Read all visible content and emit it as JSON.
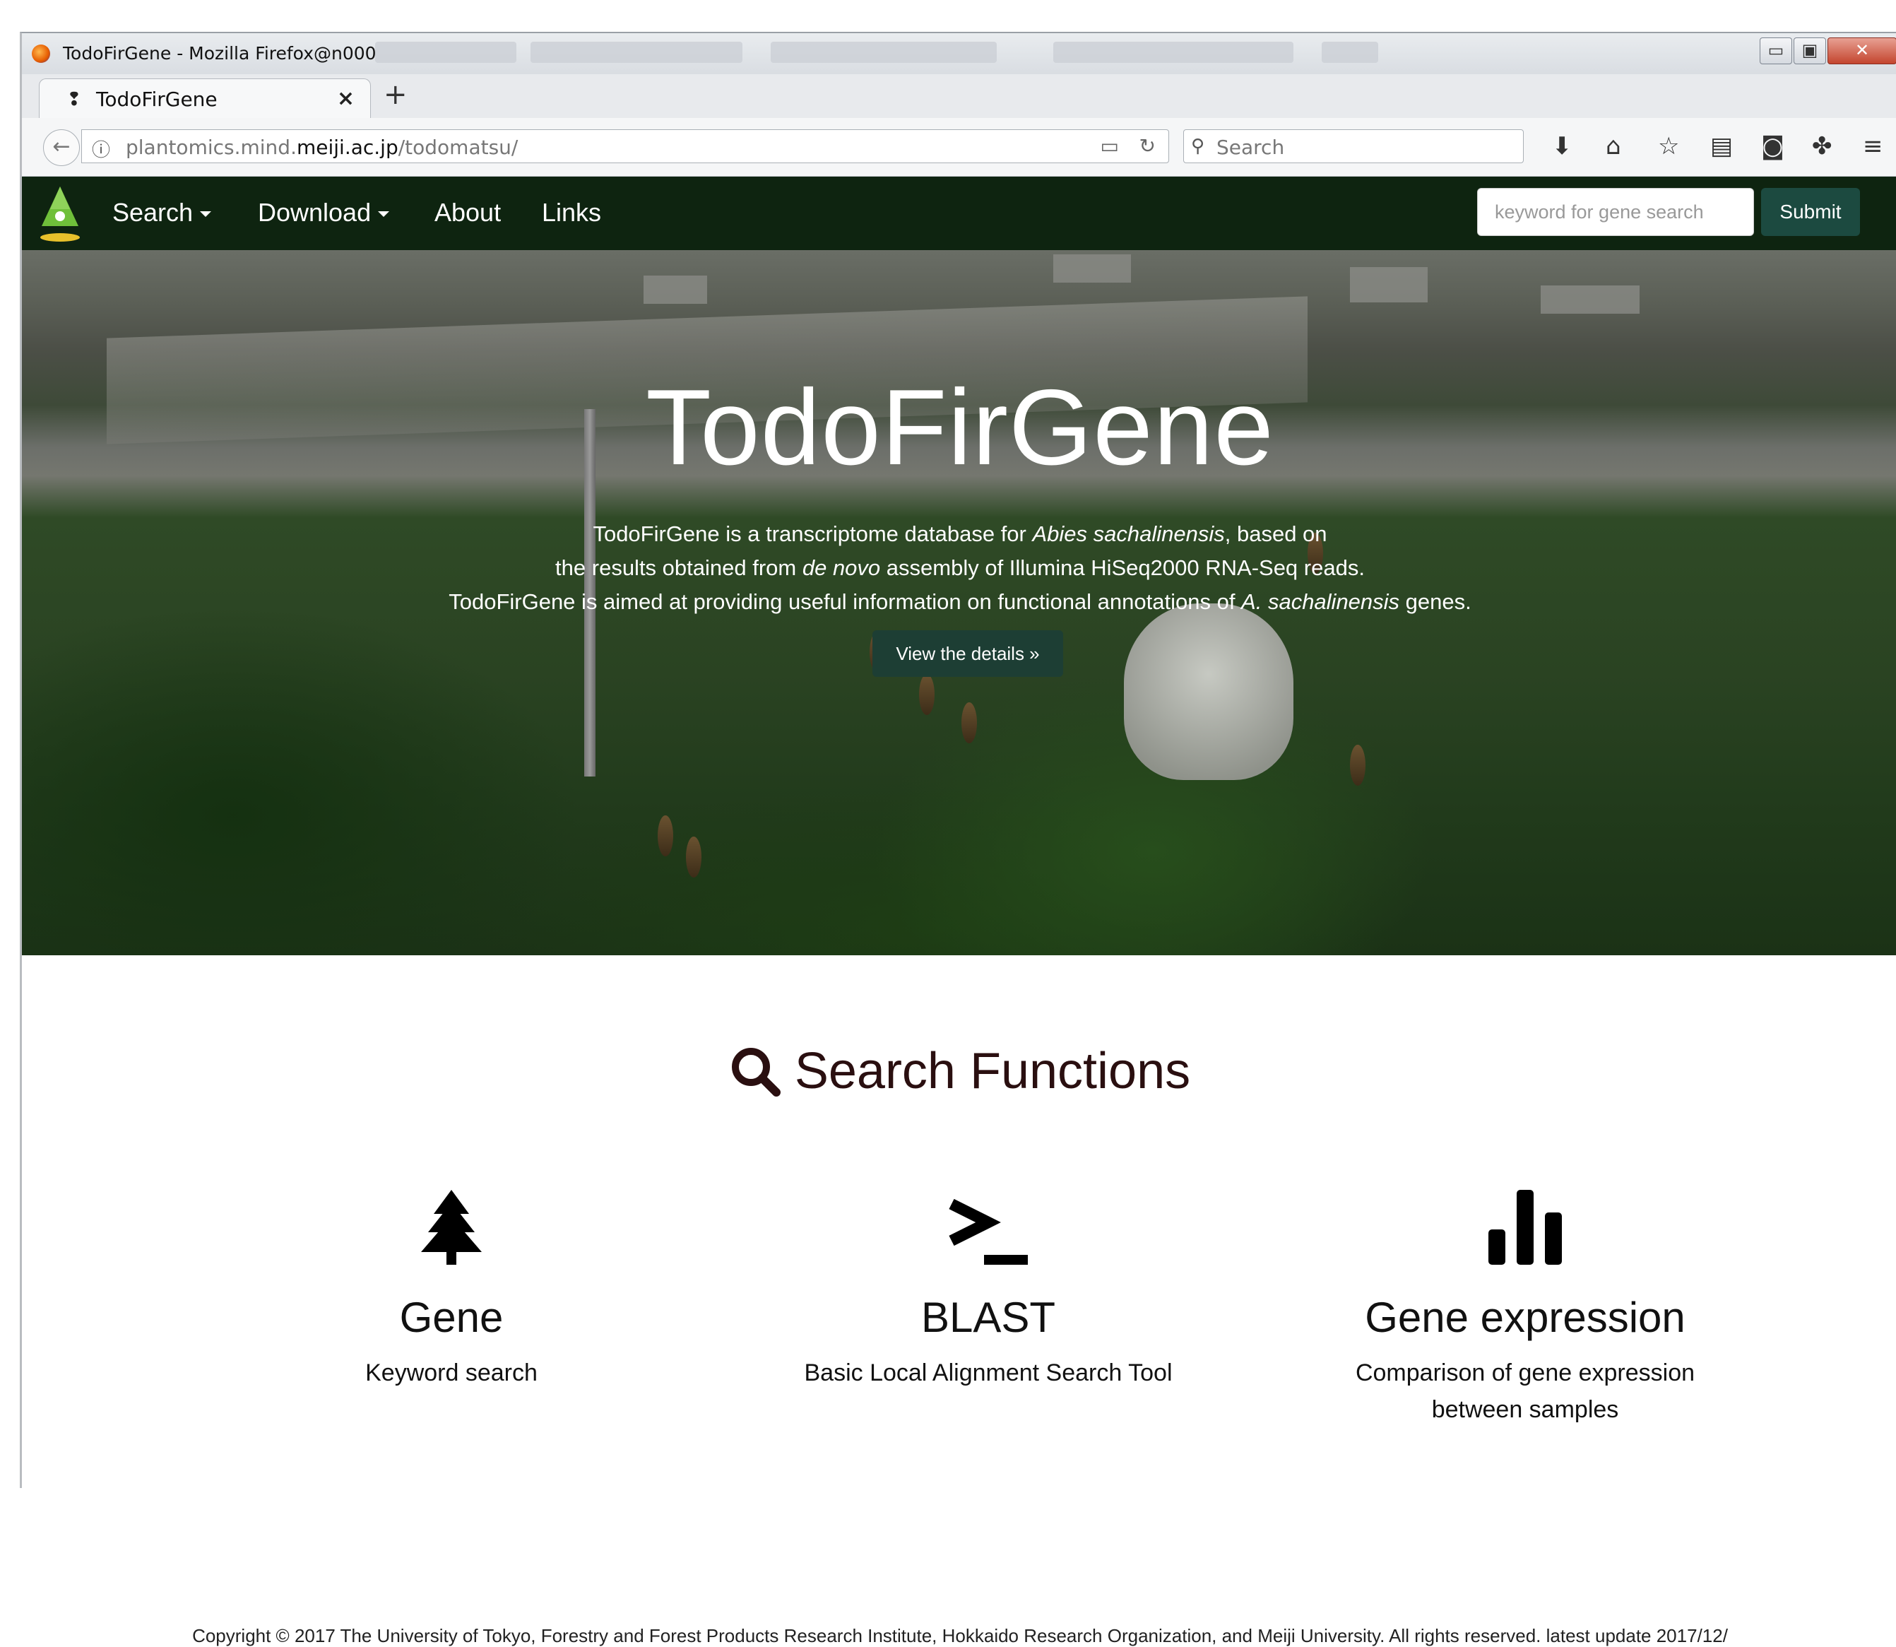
{
  "window": {
    "title": "TodoFirGene - Mozilla Firefox@n000",
    "controls": {
      "minimize": "▭",
      "maximize": "▣",
      "close": "✕"
    }
  },
  "tabs": [
    {
      "label": "TodoFirGene",
      "close": "×",
      "new_tab": "+"
    }
  ],
  "toolbar": {
    "back": "←",
    "info": "ⓘ",
    "url_prefix": "plantomics.mind.",
    "url_domain": "meiji.ac.jp",
    "url_path": "/todomatsu/",
    "search_placeholder": "Search",
    "icons": [
      "download-icon",
      "home-icon",
      "bookmark-star-icon",
      "reading-list-icon",
      "pocket-icon",
      "extension-icon",
      "menu-icon"
    ]
  },
  "site_nav": {
    "items": [
      {
        "label": "Search",
        "dropdown": true
      },
      {
        "label": "Download",
        "dropdown": true
      },
      {
        "label": "About",
        "dropdown": false
      },
      {
        "label": "Links",
        "dropdown": false
      }
    ],
    "search_placeholder": "keyword for gene search",
    "submit_label": "Submit",
    "brand_color": "#0e2410"
  },
  "hero": {
    "title": "TodoFirGene",
    "line1_a": "TodoFirGene is a transcriptome database for ",
    "line1_em": "Abies sachalinensis",
    "line1_b": ", based on",
    "line2_a": "the results obtained from ",
    "line2_em": "de novo",
    "line2_b": " assembly of Illumina HiSeq2000 RNA-Seq reads.",
    "line3_a": "TodoFirGene is aimed at providing useful information on functional annotations of ",
    "line3_em": "A. sachalinensis",
    "line3_b": " genes.",
    "button": "View the details »"
  },
  "search_functions": {
    "title": "Search Functions",
    "items": [
      {
        "name": "Gene",
        "desc": "Keyword search",
        "icon": "tree-icon"
      },
      {
        "name": "BLAST",
        "desc": "Basic Local Alignment Search Tool",
        "icon": "terminal-icon"
      },
      {
        "name": "Gene expression",
        "desc1": "Comparison of gene expression",
        "desc2": "between samples",
        "icon": "bar-chart-icon"
      }
    ]
  },
  "footer": {
    "copyright": "Copyright © 2017 The University of Tokyo, Forestry and Forest Products Research Institute, Hokkaido Research Organization, and Meiji University. All rights reserved. latest update 2017/12/"
  },
  "colors": {
    "accent": "#1c4a40",
    "title_text": "#2a0f10"
  }
}
